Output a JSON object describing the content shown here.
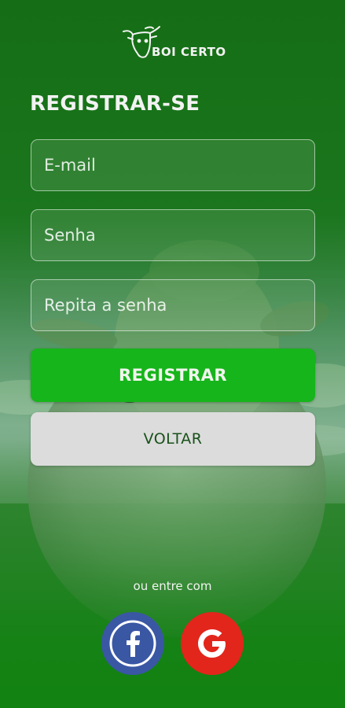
{
  "brand": {
    "name": "BOI CERTO"
  },
  "page": {
    "title": "REGISTRAR-SE"
  },
  "form": {
    "email": {
      "placeholder": "E-mail",
      "value": ""
    },
    "password": {
      "placeholder": "Senha",
      "value": ""
    },
    "password_repeat": {
      "placeholder": "Repita a senha",
      "value": ""
    }
  },
  "buttons": {
    "register_label": "REGISTRAR",
    "back_label": "VOLTAR"
  },
  "social": {
    "caption": "ou entre com",
    "providers": [
      {
        "name": "facebook",
        "icon": "facebook-icon",
        "color": "#3a57a4"
      },
      {
        "name": "google",
        "icon": "google-icon",
        "color": "#e2261c"
      }
    ]
  },
  "colors": {
    "primary_green": "#16b51b",
    "background_green": "#167a16",
    "secondary_button": "#dcdcdc"
  }
}
